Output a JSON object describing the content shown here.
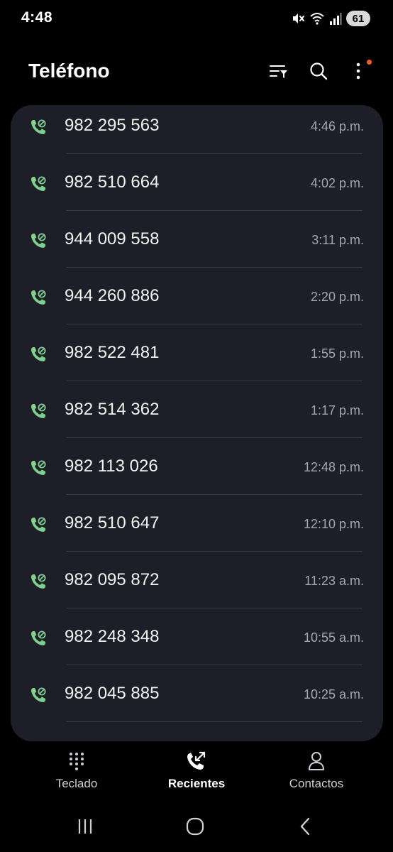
{
  "status_bar": {
    "time": "4:48",
    "battery": "61",
    "icons": [
      "mute-icon",
      "wifi-icon",
      "signal-icon",
      "battery-icon"
    ]
  },
  "header": {
    "title": "Teléfono",
    "actions": [
      "filter-icon",
      "search-icon",
      "more-options-icon"
    ],
    "notification_dot_color": "#ff5a1f"
  },
  "calls": [
    {
      "number": "982 295 563",
      "time": "4:46 p.m."
    },
    {
      "number": "982 510 664",
      "time": "4:02 p.m."
    },
    {
      "number": "944 009 558",
      "time": "3:11 p.m."
    },
    {
      "number": "944 260 886",
      "time": "2:20 p.m."
    },
    {
      "number": "982 522 481",
      "time": "1:55 p.m."
    },
    {
      "number": "982 514 362",
      "time": "1:17 p.m."
    },
    {
      "number": "982 113 026",
      "time": "12:48 p.m."
    },
    {
      "number": "982 510 647",
      "time": "12:10 p.m."
    },
    {
      "number": "982 095 872",
      "time": "11:23 a.m."
    },
    {
      "number": "982 248 348",
      "time": "10:55 a.m."
    },
    {
      "number": "982 045 885",
      "time": "10:25 a.m."
    }
  ],
  "call_icon": "incoming-call-icon",
  "colors": {
    "call_icon": "#7ed38a",
    "card_background": "#1e1e28",
    "background": "#000000"
  },
  "tabs": [
    {
      "label": "Teclado",
      "icon": "keypad-icon",
      "active": false
    },
    {
      "label": "Recientes",
      "icon": "recents-icon",
      "active": true
    },
    {
      "label": "Contactos",
      "icon": "contacts-icon",
      "active": false
    }
  ],
  "nav_bar": [
    "recent-apps-icon",
    "home-icon",
    "back-icon"
  ]
}
